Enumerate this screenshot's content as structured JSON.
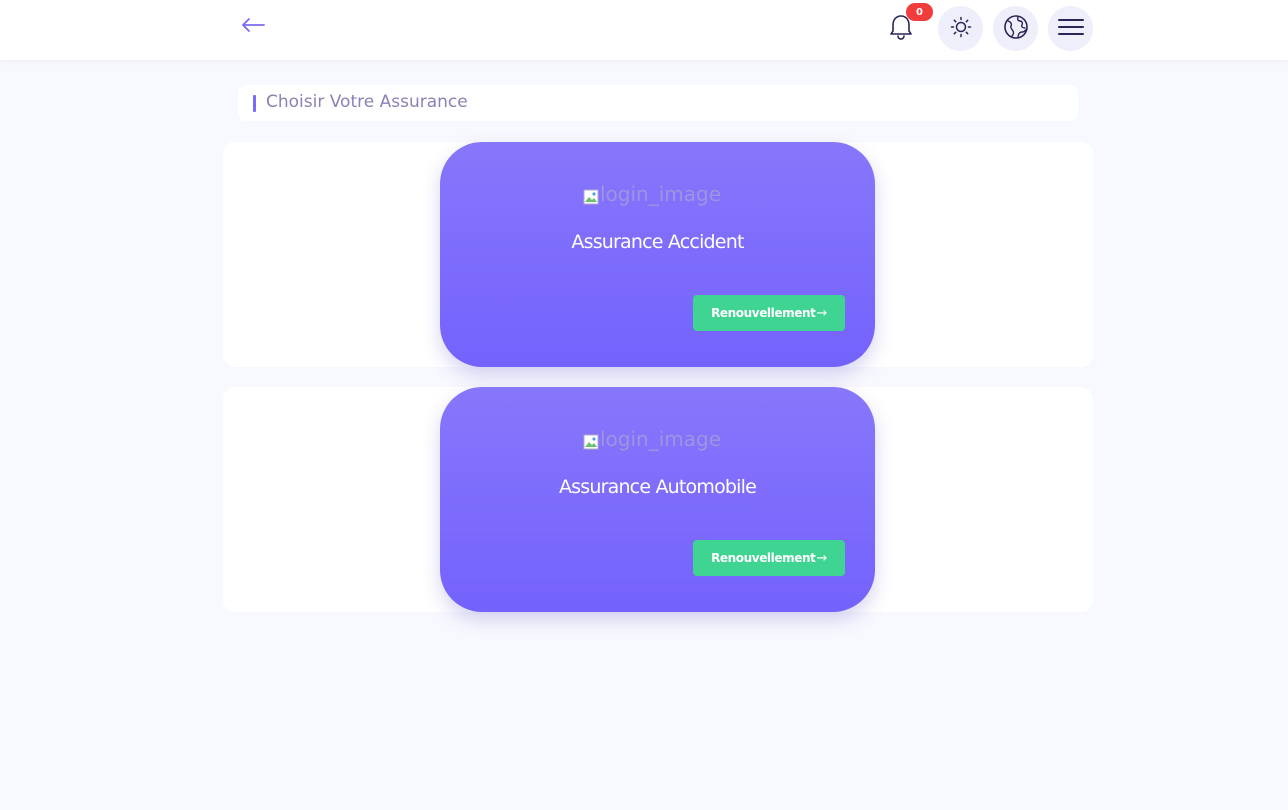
{
  "header": {
    "back_icon": "arrow-left-icon",
    "notifications": {
      "icon": "bell-icon",
      "count": "0",
      "badge_color": "#f13c3c"
    },
    "theme_toggle": {
      "icon": "sun-icon"
    },
    "language": {
      "icon": "globe-icon"
    },
    "menu": {
      "icon": "hamburger-menu-icon"
    }
  },
  "page": {
    "title": "Choisir Votre Assurance"
  },
  "cards": [
    {
      "image_alt": "login_image",
      "title": "Assurance Accident",
      "button_label": "Renouvellement",
      "button_arrow": "→"
    },
    {
      "image_alt": "login_image",
      "title": "Assurance Automobile",
      "button_label": "Renouvellement",
      "button_arrow": "→"
    }
  ],
  "colors": {
    "accent": "#7b6cf6",
    "card_gradient_top": "#8777fb",
    "card_gradient_bottom": "#7462fd",
    "button_green": "#3fd492",
    "background": "#f8f9fe"
  }
}
